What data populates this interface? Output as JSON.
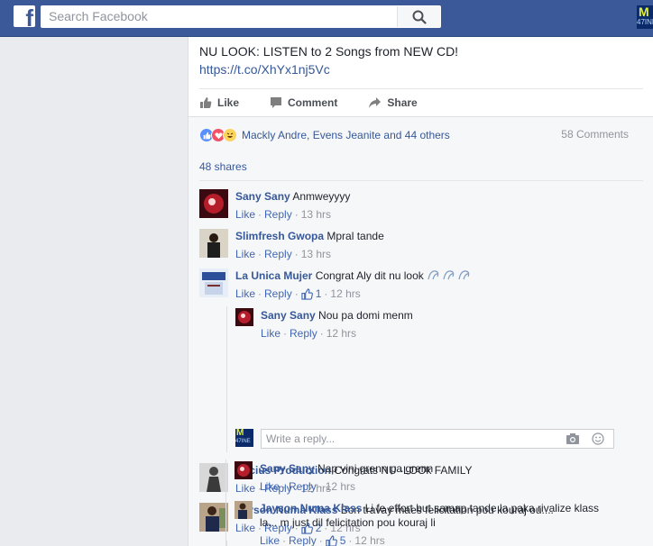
{
  "topbar": {
    "logo": "f",
    "search_placeholder": "Search Facebook",
    "profile_label": "M",
    "profile_sub": "47INE"
  },
  "post": {
    "text": "NU LOOK: LISTEN to 2 Songs from NEW CD!",
    "link": "https://t.co/XhYx1nj5Vc",
    "actions": {
      "like": "Like",
      "comment": "Comment",
      "share": "Share"
    },
    "reactions_text": "Mackly Andre, Evens Jeanite and 44 others",
    "comments_count": "58 Comments",
    "shares": "48 shares"
  },
  "labels": {
    "like": "Like",
    "reply": "Reply",
    "dot": "·"
  },
  "comments": [
    {
      "name": "Sany Sany",
      "text": "Anmweyyyy",
      "time": "13 hrs"
    },
    {
      "name": "Slimfresh Gwopa",
      "text": "Mpral tande",
      "time": "13 hrs"
    },
    {
      "name": "La Unica Mujer",
      "text": "Congrat Aly dit nu look",
      "likes": "1",
      "time": "12 hrs"
    },
    {
      "name": "Sany Sany",
      "text": "Nou pa domi menm",
      "time": "12 hrs"
    },
    {
      "name": "Accius Production",
      "text": "Congrats NU -LOOk FAMILY",
      "time": "12 hrs"
    },
    {
      "name": "Jayson Numa Klass",
      "text": "Bon travay maes felicitation pou kouraj ou....",
      "likes": "2",
      "time": "12 hrs"
    },
    {
      "name": "Sany Sany",
      "text": "Nap vini grenn pa grenn",
      "time": "12 hrs"
    },
    {
      "name": "Jayson Numa Klass",
      "text": "Li fe effort but samap tande la paka rivalize klass",
      "text2": "la... m just dil felicitation pou kouraj li",
      "likes": "5",
      "time": "12 hrs"
    }
  ],
  "reply_box": {
    "placeholder": "Write a reply..."
  },
  "colors": {
    "topbar": "#3b5998",
    "link": "#365899",
    "meta": "#90949c"
  }
}
